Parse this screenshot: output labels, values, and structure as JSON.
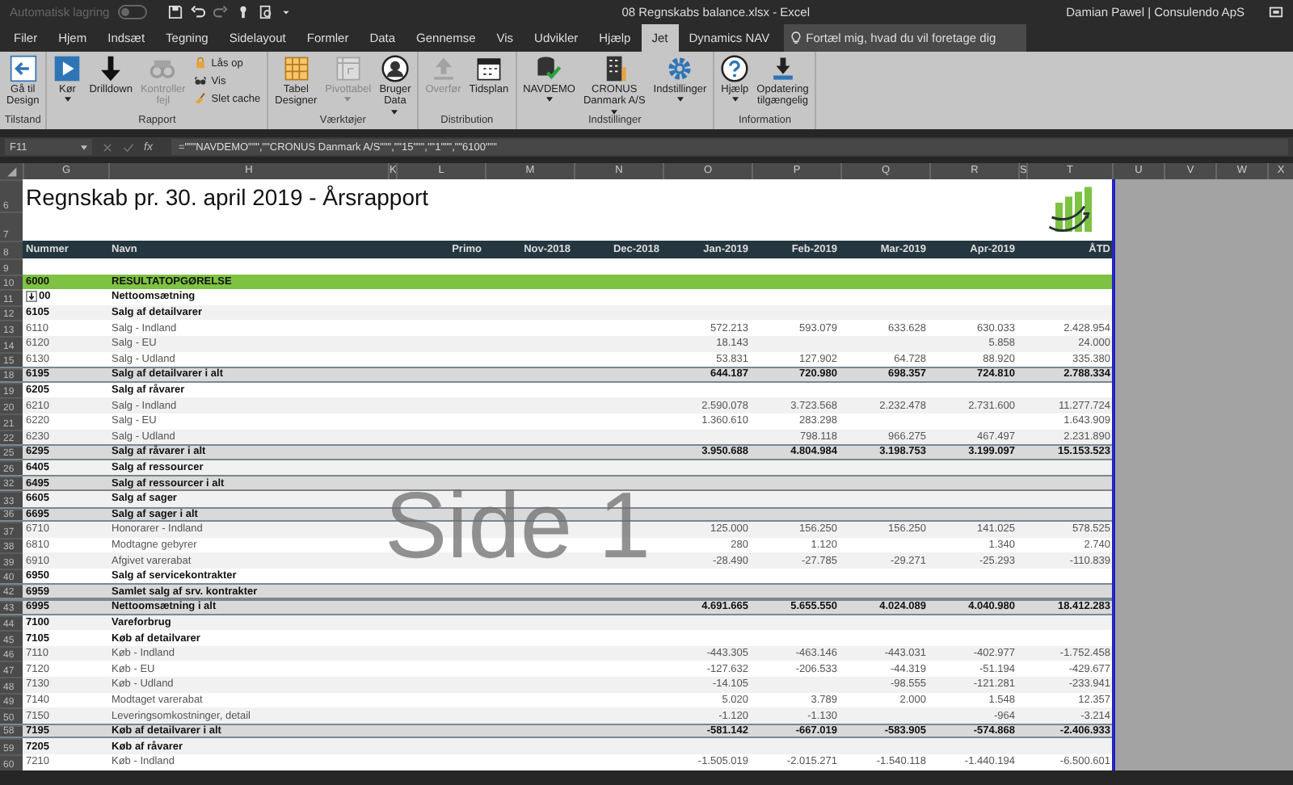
{
  "title_bar": {
    "autosave": {
      "label": "Automatisk lagring",
      "on": false
    },
    "title": "08 Regnskabs balance.xlsx  -  Excel",
    "user": "Damian Pawel | Consulendo ApS"
  },
  "ribbon_tabs": [
    {
      "label": "Filer",
      "selected": false
    },
    {
      "label": "Hjem",
      "selected": false
    },
    {
      "label": "Indsæt",
      "selected": false
    },
    {
      "label": "Tegning",
      "selected": false
    },
    {
      "label": "Sidelayout",
      "selected": false
    },
    {
      "label": "Formler",
      "selected": false
    },
    {
      "label": "Data",
      "selected": false
    },
    {
      "label": "Gennemse",
      "selected": false
    },
    {
      "label": "Vis",
      "selected": false
    },
    {
      "label": "Udvikler",
      "selected": false
    },
    {
      "label": "Hjælp",
      "selected": false
    },
    {
      "label": "Jet",
      "selected": true
    },
    {
      "label": "Dynamics NAV",
      "selected": false
    }
  ],
  "tell_me": {
    "placeholder": "Fortæl mig, hvad du vil foretage dig"
  },
  "ribbon_groups": [
    {
      "label": "Tilstand",
      "buttons": [
        {
          "label": "Gå til\nDesign",
          "kind": "large",
          "disabled": false,
          "dropdown": false
        }
      ]
    },
    {
      "label": "Rapport",
      "buttons": [
        {
          "label": "Kør",
          "kind": "large",
          "disabled": false,
          "dropdown": true
        },
        {
          "label": "Drilldown",
          "kind": "large",
          "disabled": false,
          "dropdown": false
        },
        {
          "label": "Kontroller\nfejl",
          "kind": "large",
          "disabled": true,
          "dropdown": false
        },
        {
          "label": "Lås op",
          "kind": "small",
          "disabled": false
        },
        {
          "label": "Vis",
          "kind": "small",
          "disabled": false
        },
        {
          "label": "Slet cache",
          "kind": "small",
          "disabled": false
        }
      ]
    },
    {
      "label": "Værktøjer",
      "buttons": [
        {
          "label": "Tabel\nDesigner",
          "kind": "large",
          "disabled": false,
          "dropdown": false
        },
        {
          "label": "Pivottabel",
          "kind": "large",
          "disabled": true,
          "dropdown": true
        },
        {
          "label": "Bruger\nData",
          "kind": "large",
          "disabled": false,
          "dropdown": true
        }
      ]
    },
    {
      "label": "Distribution",
      "buttons": [
        {
          "label": "Overfør",
          "kind": "large",
          "disabled": true,
          "dropdown": false
        },
        {
          "label": "Tidsplan",
          "kind": "large",
          "disabled": false,
          "dropdown": false
        }
      ]
    },
    {
      "label": "Indstillinger",
      "buttons": [
        {
          "label": "NAVDEMO",
          "kind": "large",
          "disabled": false,
          "dropdown": true
        },
        {
          "label": "CRONUS\nDanmark A/S",
          "kind": "large",
          "disabled": false,
          "dropdown": true
        },
        {
          "label": "Indstillinger",
          "kind": "large",
          "disabled": false,
          "dropdown": true
        }
      ]
    },
    {
      "label": "Information",
      "buttons": [
        {
          "label": "Hjælp",
          "kind": "large",
          "disabled": false,
          "dropdown": true
        },
        {
          "label": "Opdatering\ntilgængelig",
          "kind": "large",
          "disabled": false,
          "dropdown": false
        }
      ]
    }
  ],
  "formula_bar": {
    "name_box": "F11",
    "function_label": "fx",
    "formula": "=\"\"\"NAVDEMO\"\"\",\"\"CRONUS Danmark A/S\"\"\",\"\"15\"\"\",\"\"1\"\"\",\"\"6100\"\"\""
  },
  "column_headers": [
    "G",
    "H",
    "K",
    "L",
    "M",
    "N",
    "O",
    "P",
    "Q",
    "R",
    "S",
    "T",
    "U",
    "V",
    "W",
    "X"
  ],
  "sheet": {
    "title_row": "6",
    "title": "Regnskab pr. 30. april 2019 - Årsrapport",
    "logo_row": "7",
    "header_row": "8",
    "headers": [
      "Nummer",
      "Navn",
      "Primo",
      "Nov-2018",
      "Dec-2018",
      "Jan-2019",
      "Feb-2019",
      "Mar-2019",
      "Apr-2019",
      "ÅTD"
    ],
    "blank_row": "9",
    "rows": [
      {
        "row": "10",
        "kind": "section",
        "number": "6000",
        "name": "RESULTATOPGØRELSE"
      },
      {
        "row": "11",
        "kind": "heading",
        "number": "00",
        "name": "Nettoomsætning",
        "cell_button": true
      },
      {
        "row": "12",
        "kind": "heading",
        "number": "6105",
        "name": "Salg af detailvarer"
      },
      {
        "row": "13",
        "kind": "detail",
        "number": "6110",
        "name": "Salg - Indland",
        "jan": "572.213",
        "feb": "593.079",
        "mar": "633.628",
        "apr": "630.033",
        "atd": "2.428.954"
      },
      {
        "row": "14",
        "kind": "detail",
        "number": "6120",
        "name": "Salg - EU",
        "jan": "18.143",
        "apr": "5.858",
        "atd": "24.000"
      },
      {
        "row": "15",
        "kind": "detail",
        "number": "6130",
        "name": "Salg - Udland",
        "jan": "53.831",
        "feb": "127.902",
        "mar": "64.728",
        "apr": "88.920",
        "atd": "335.380"
      },
      {
        "row": "18",
        "kind": "total",
        "number": "6195",
        "name": "Salg af detailvarer i alt",
        "jan": "644.187",
        "feb": "720.980",
        "mar": "698.357",
        "apr": "724.810",
        "atd": "2.788.334"
      },
      {
        "row": "19",
        "kind": "heading",
        "number": "6205",
        "name": "Salg af råvarer"
      },
      {
        "row": "20",
        "kind": "detail",
        "number": "6210",
        "name": "Salg - Indland",
        "jan": "2.590.078",
        "feb": "3.723.568",
        "mar": "2.232.478",
        "apr": "2.731.600",
        "atd": "11.277.724"
      },
      {
        "row": "21",
        "kind": "detail",
        "number": "6220",
        "name": "Salg - EU",
        "jan": "1.360.610",
        "feb": "283.298",
        "atd": "1.643.909"
      },
      {
        "row": "22",
        "kind": "detail",
        "number": "6230",
        "name": "Salg - Udland",
        "feb": "798.118",
        "mar": "966.275",
        "apr": "467.497",
        "atd": "2.231.890"
      },
      {
        "row": "25",
        "kind": "total",
        "number": "6295",
        "name": "Salg af råvarer i alt",
        "jan": "3.950.688",
        "feb": "4.804.984",
        "mar": "3.198.753",
        "apr": "3.199.097",
        "atd": "15.153.523"
      },
      {
        "row": "26",
        "kind": "heading",
        "number": "6405",
        "name": "Salg af ressourcer"
      },
      {
        "row": "32",
        "kind": "total",
        "number": "6495",
        "name": "Salg af ressourcer i alt"
      },
      {
        "row": "33",
        "kind": "heading",
        "number": "6605",
        "name": "Salg af sager"
      },
      {
        "row": "36",
        "kind": "total",
        "number": "6695",
        "name": "Salg af sager i alt"
      },
      {
        "row": "37",
        "kind": "detail",
        "number": "6710",
        "name": "Honorarer - Indland",
        "jan": "125.000",
        "feb": "156.250",
        "mar": "156.250",
        "apr": "141.025",
        "atd": "578.525"
      },
      {
        "row": "38",
        "kind": "detail",
        "number": "6810",
        "name": "Modtagne gebyrer",
        "jan": "280",
        "feb": "1.120",
        "apr": "1.340",
        "atd": "2.740"
      },
      {
        "row": "39",
        "kind": "detail",
        "number": "6910",
        "name": "Afgivet varerabat",
        "jan": "-28.490",
        "feb": "-27.785",
        "mar": "-29.271",
        "apr": "-25.293",
        "atd": "-110.839"
      },
      {
        "row": "40",
        "kind": "heading",
        "number": "6950",
        "name": "Salg af servicekontrakter"
      },
      {
        "row": "42",
        "kind": "total",
        "number": "6959",
        "name": "Samlet salg af srv. kontrakter"
      },
      {
        "row": "43",
        "kind": "total",
        "number": "6995",
        "name": "Nettoomsætning i alt",
        "jan": "4.691.665",
        "feb": "5.655.550",
        "mar": "4.024.089",
        "apr": "4.040.980",
        "atd": "18.412.283"
      },
      {
        "row": "44",
        "kind": "heading",
        "number": "7100",
        "name": "Vareforbrug"
      },
      {
        "row": "45",
        "kind": "heading",
        "number": "7105",
        "name": "Køb af detailvarer"
      },
      {
        "row": "46",
        "kind": "detail",
        "number": "7110",
        "name": "Køb - Indland",
        "jan": "-443.305",
        "feb": "-463.146",
        "mar": "-443.031",
        "apr": "-402.977",
        "atd": "-1.752.458"
      },
      {
        "row": "47",
        "kind": "detail",
        "number": "7120",
        "name": "Køb - EU",
        "jan": "-127.632",
        "feb": "-206.533",
        "mar": "-44.319",
        "apr": "-51.194",
        "atd": "-429.677"
      },
      {
        "row": "48",
        "kind": "detail",
        "number": "7130",
        "name": "Køb - Udland",
        "jan": "-14.105",
        "mar": "-98.555",
        "apr": "-121.281",
        "atd": "-233.941"
      },
      {
        "row": "49",
        "kind": "detail",
        "number": "7140",
        "name": "Modtaget varerabat",
        "jan": "5.020",
        "feb": "3.789",
        "mar": "2.000",
        "apr": "1.548",
        "atd": "12.357"
      },
      {
        "row": "50",
        "kind": "detail",
        "number": "7150",
        "name": "Leveringsomkostninger, detail",
        "jan": "-1.120",
        "feb": "-1.130",
        "apr": "-964",
        "atd": "-3.214"
      },
      {
        "row": "58",
        "kind": "total",
        "number": "7195",
        "name": "Køb af detailvarer i alt",
        "jan": "-581.142",
        "feb": "-667.019",
        "mar": "-583.905",
        "apr": "-574.868",
        "atd": "-2.406.933"
      },
      {
        "row": "59",
        "kind": "heading",
        "number": "7205",
        "name": "Køb af råvarer"
      },
      {
        "row": "60",
        "kind": "detail",
        "number": "7210",
        "name": "Køb - Indland",
        "jan": "-1.505.019",
        "feb": "-2.015.271",
        "mar": "-1.540.118",
        "apr": "-1.440.194",
        "atd": "-6.500.601"
      }
    ],
    "page_label": "Side 1"
  }
}
